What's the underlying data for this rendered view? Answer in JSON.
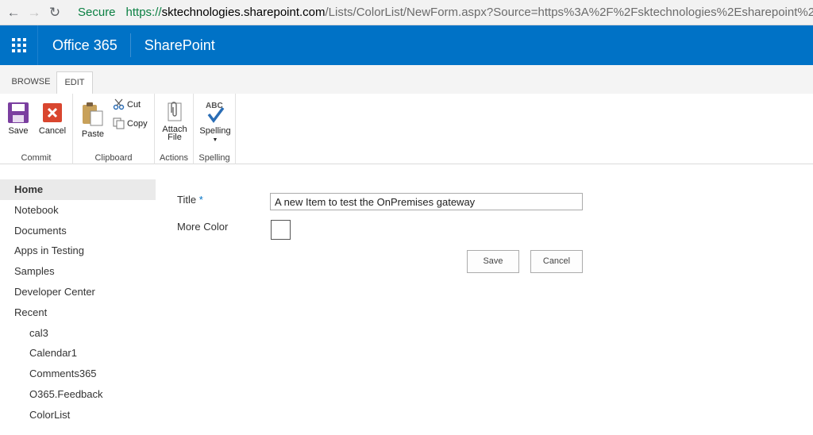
{
  "browser": {
    "secure_label": "Secure",
    "url_proto": "https://",
    "url_host": "sktechnologies.sharepoint.com",
    "url_rest": "/Lists/ColorList/NewForm.aspx?Source=https%3A%2F%2Fsktechnologies%2Esharepoint%2Eco"
  },
  "suite": {
    "brand": "Office 365",
    "app": "SharePoint"
  },
  "ribbon": {
    "tabs": [
      "BROWSE",
      "EDIT"
    ],
    "active_tab": "EDIT",
    "groups": {
      "commit": {
        "label": "Commit",
        "save": "Save",
        "cancel": "Cancel"
      },
      "clipboard": {
        "label": "Clipboard",
        "paste": "Paste",
        "cut": "Cut",
        "copy": "Copy"
      },
      "actions": {
        "label": "Actions",
        "attach_line1": "Attach",
        "attach_line2": "File"
      },
      "spelling": {
        "label": "Spelling",
        "spelling": "Spelling",
        "abc": "ABC"
      }
    }
  },
  "leftnav": {
    "items": [
      "Home",
      "Notebook",
      "Documents",
      "Apps in Testing",
      "Samples",
      "Developer Center",
      "Recent"
    ],
    "recent": [
      "cal3",
      "Calendar1",
      "Comments365",
      "O365.Feedback",
      "ColorList"
    ],
    "selected": "Home"
  },
  "form": {
    "title_label": "Title",
    "required_marker": "*",
    "title_value": "A new Item to test the OnPremises gateway",
    "color_label": "More Color",
    "save": "Save",
    "cancel": "Cancel"
  },
  "colors": {
    "suite_bar": "#0072c6",
    "secure_green": "#0b8043",
    "save_icon": "#7b3fa0",
    "cancel_icon": "#d9462f"
  }
}
